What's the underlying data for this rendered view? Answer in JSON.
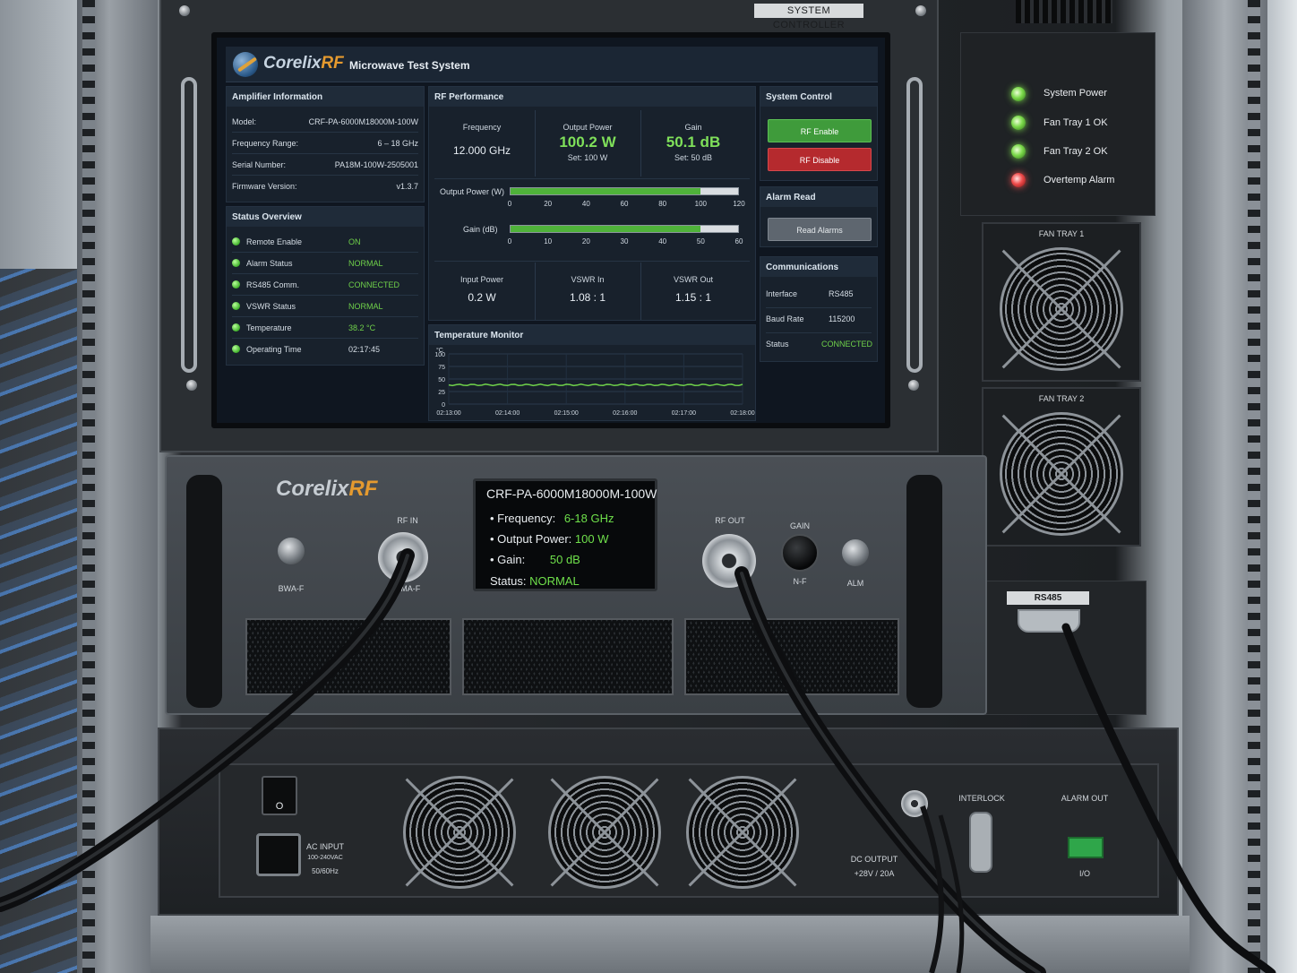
{
  "controller_label": "SYSTEM CONTROLLER",
  "app": {
    "logo_main": "Corelix",
    "logo_accent": "RF",
    "title": "Microwave Test System"
  },
  "amplifier_info": {
    "title": "Amplifier Information",
    "rows": [
      {
        "label": "Model:",
        "value": "CRF-PA-6000M18000M-100W"
      },
      {
        "label": "Frequency Range:",
        "value": "6 – 18 GHz"
      },
      {
        "label": "Serial Number:",
        "value": "PA18M-100W-2505001"
      },
      {
        "label": "Firmware Version:",
        "value": "v1.3.7"
      }
    ]
  },
  "status_overview": {
    "title": "Status Overview",
    "rows": [
      {
        "label": "Remote Enable",
        "value": "ON"
      },
      {
        "label": "Alarm Status",
        "value": "NORMAL"
      },
      {
        "label": "RS485 Comm.",
        "value": "CONNECTED"
      },
      {
        "label": "VSWR Status",
        "value": "NORMAL"
      },
      {
        "label": "Temperature",
        "value": "38.2 °C"
      },
      {
        "label": "Operating Time",
        "value": "02:17:45"
      }
    ]
  },
  "rf_performance": {
    "title": "RF Performance",
    "frequency": {
      "label": "Frequency",
      "value": "12.000 GHz"
    },
    "output_power": {
      "label": "Output Power",
      "value": "100.2 W",
      "set": "Set:   100 W"
    },
    "gain": {
      "label": "Gain",
      "value": "50.1 dB",
      "set": "Set:   50 dB"
    },
    "output_bar": {
      "label": "Output Power (W)",
      "ticks": [
        "0",
        "20",
        "40",
        "60",
        "80",
        "100",
        "120"
      ],
      "level": 0.835,
      "max": 120
    },
    "gain_bar": {
      "label": "Gain (dB)",
      "ticks": [
        "0",
        "10",
        "20",
        "30",
        "40",
        "50",
        "60"
      ],
      "level": 0.835,
      "max": 60
    },
    "input_power": {
      "label": "Input Power",
      "value": "0.2 W"
    },
    "vswr_in": {
      "label": "VSWR In",
      "value": "1.08 : 1"
    },
    "vswr_out": {
      "label": "VSWR Out",
      "value": "1.15 : 1"
    }
  },
  "temperature_monitor": {
    "title": "Temperature Monitor",
    "unit": "°C",
    "y_ticks": [
      "100",
      "75",
      "50",
      "25",
      "0"
    ],
    "x_ticks": [
      "02:13:00",
      "02:14:00",
      "02:15:00",
      "02:16:00",
      "02:17:00",
      "02:18:00"
    ],
    "ylim": [
      0,
      100
    ],
    "series_value": 38.2
  },
  "system_control": {
    "title": "System Control",
    "enable_label": "RF Enable",
    "disable_label": "RF Disable"
  },
  "alarm_read": {
    "title": "Alarm Read",
    "button_label": "Read Alarms"
  },
  "communications": {
    "title": "Communications",
    "rows": [
      {
        "label": "Interface",
        "value": "RS485"
      },
      {
        "label": "Baud Rate",
        "value": "115200"
      },
      {
        "label": "Status",
        "value": "CONNECTED"
      }
    ]
  },
  "leds": [
    {
      "label": "System Power",
      "color": "#7bd94a"
    },
    {
      "label": "Fan Tray 1 OK",
      "color": "#7bd94a"
    },
    {
      "label": "Fan Tray 2 OK",
      "color": "#7bd94a"
    },
    {
      "label": "Overtemp Alarm",
      "color": "#ef4b4b"
    }
  ],
  "fan_tray_1": "FAN TRAY 1",
  "fan_tray_2": "FAN TRAY 2",
  "amp_front": {
    "logo_main": "Corelix",
    "logo_accent": "RF",
    "rf_in": "RF IN",
    "rf_in_connector": "NMA-F",
    "left_button_label": "BWA-F",
    "rf_out": "RF OUT",
    "gain_label": "GAIN",
    "gain_sub": "N-F",
    "alm_label": "ALM",
    "lcd": {
      "model": "CRF-PA-6000M18000M-100W",
      "frequency_label": "• Frequency:",
      "frequency_value": "6-18 GHz",
      "power_label": "• Output Power:",
      "power_value": "100 W",
      "gain_label": "• Gain:",
      "gain_value": "50 dB",
      "status_label": "Status:",
      "status_value": "NORMAL"
    }
  },
  "rs485_label": "RS485",
  "psu": {
    "switch_label": "O",
    "ac_input": "AC INPUT",
    "ac_range": "100-240VAC",
    "ac_freq": "50/60Hz",
    "dc_output": "DC OUTPUT",
    "dc_spec": "+28V / 20A",
    "interlock": "INTERLOCK",
    "alarm_out": "ALARM OUT",
    "io": "I/O"
  }
}
